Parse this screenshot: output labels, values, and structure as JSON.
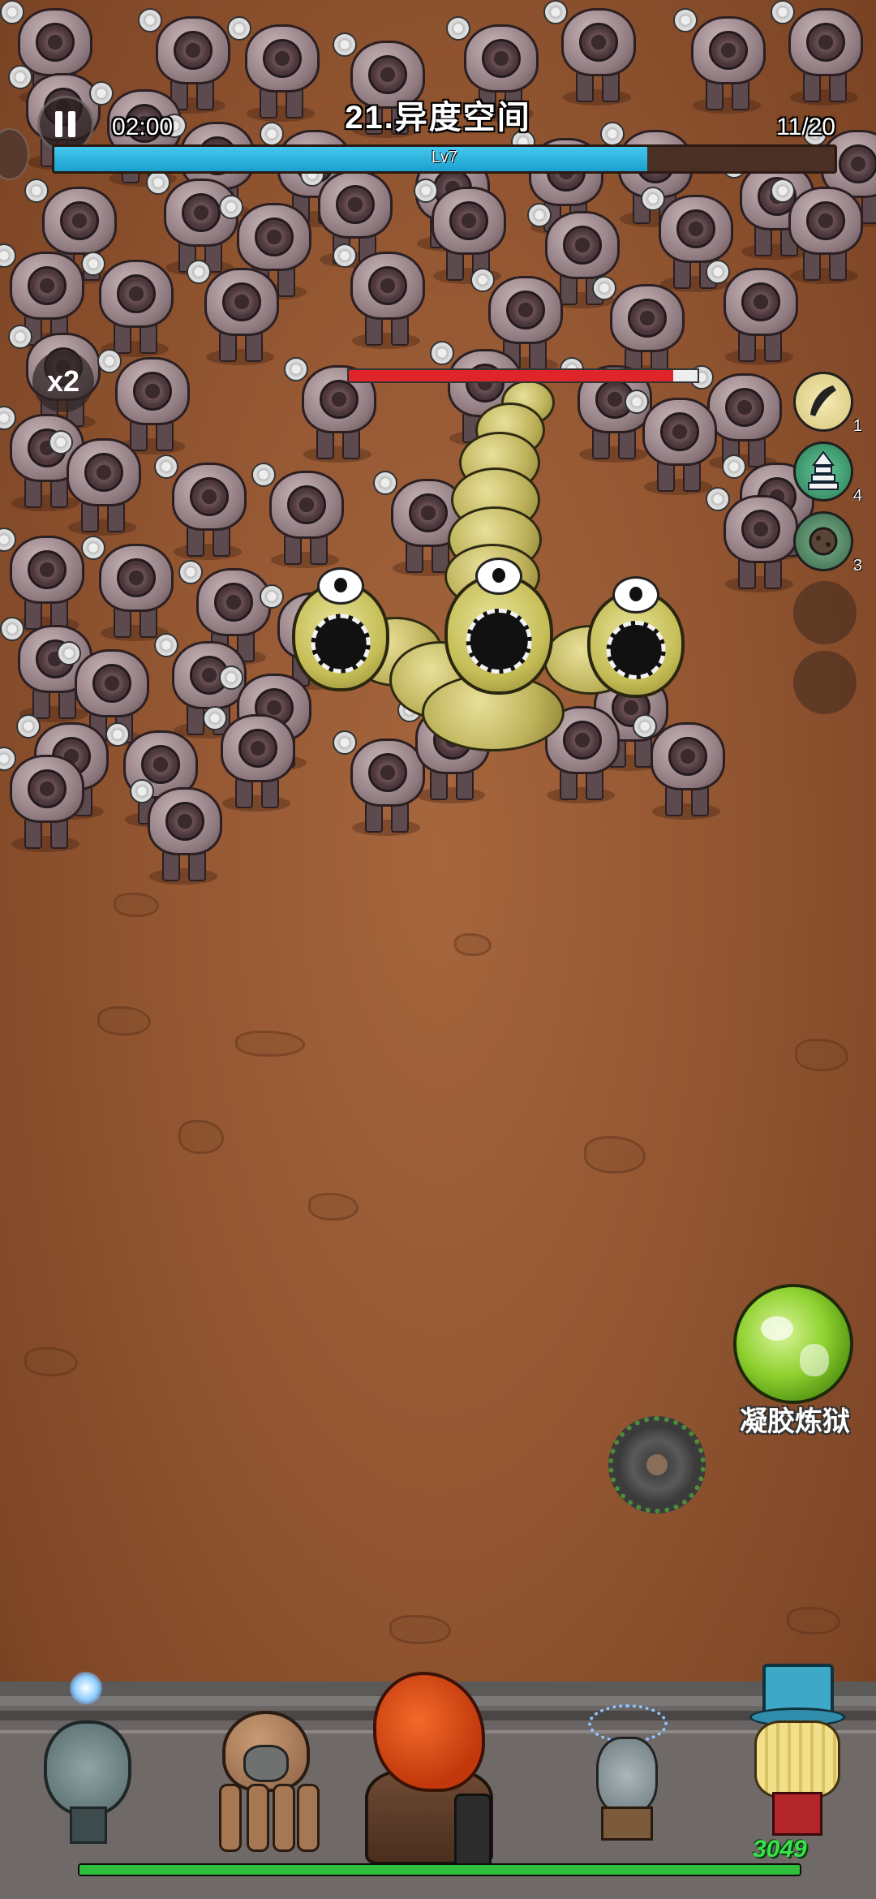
{
  "hud": {
    "timer": "02:00",
    "level_title": "21.异度空间",
    "wave_counter": "11/20",
    "xp_level_label": "Lv7",
    "xp_progress": 0.76,
    "speed_label": "x2"
  },
  "boss": {
    "hp_fraction": 0.93
  },
  "skills": [
    {
      "icon": "bullet-icon",
      "count": "1"
    },
    {
      "icon": "tower-icon",
      "count": "4"
    },
    {
      "icon": "rock-icon",
      "count": "3"
    }
  ],
  "ability": {
    "label": "凝胶炼狱",
    "icon": "gel-slime-icon"
  },
  "wall": {
    "hp_text": "3049",
    "hp_fraction": 1.0
  },
  "colors": {
    "xp_fill": "#1b9fd0",
    "boss_hp": "#e0252a",
    "wall_hp": "#2fbf3a",
    "ground": "#955833"
  }
}
